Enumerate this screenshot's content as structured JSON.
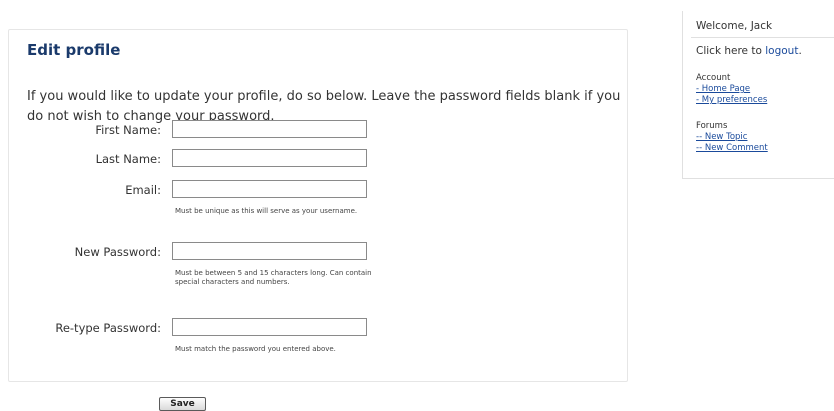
{
  "form": {
    "legend": "Edit profile",
    "intro": "If you would like to update your profile, do so below. Leave the password fields blank if you do not wish to change your password.",
    "fields": {
      "first_name": {
        "label": "First Name:",
        "value": ""
      },
      "last_name": {
        "label": "Last Name:",
        "value": ""
      },
      "email": {
        "label": "Email:",
        "value": "",
        "hint": "Must be unique as this will serve as your username."
      },
      "new_password": {
        "label": "New Password:",
        "value": "",
        "hint": "Must be between 5 and 15 characters long. Can contain special characters and numbers."
      },
      "retype_password": {
        "label": "Re-type Password:",
        "value": "",
        "hint": "Must match the password you entered above."
      }
    },
    "save_label": "Save"
  },
  "sidebar": {
    "welcome": "Welcome, Jack",
    "logout_prefix": "Click here to ",
    "logout_link": "logout",
    "logout_suffix": ".",
    "account_title": "Account",
    "account_links": [
      "- Home Page",
      "- My preferences"
    ],
    "forums_title": "Forums",
    "forums_links": [
      "-- New Topic",
      "-- New Comment"
    ]
  }
}
